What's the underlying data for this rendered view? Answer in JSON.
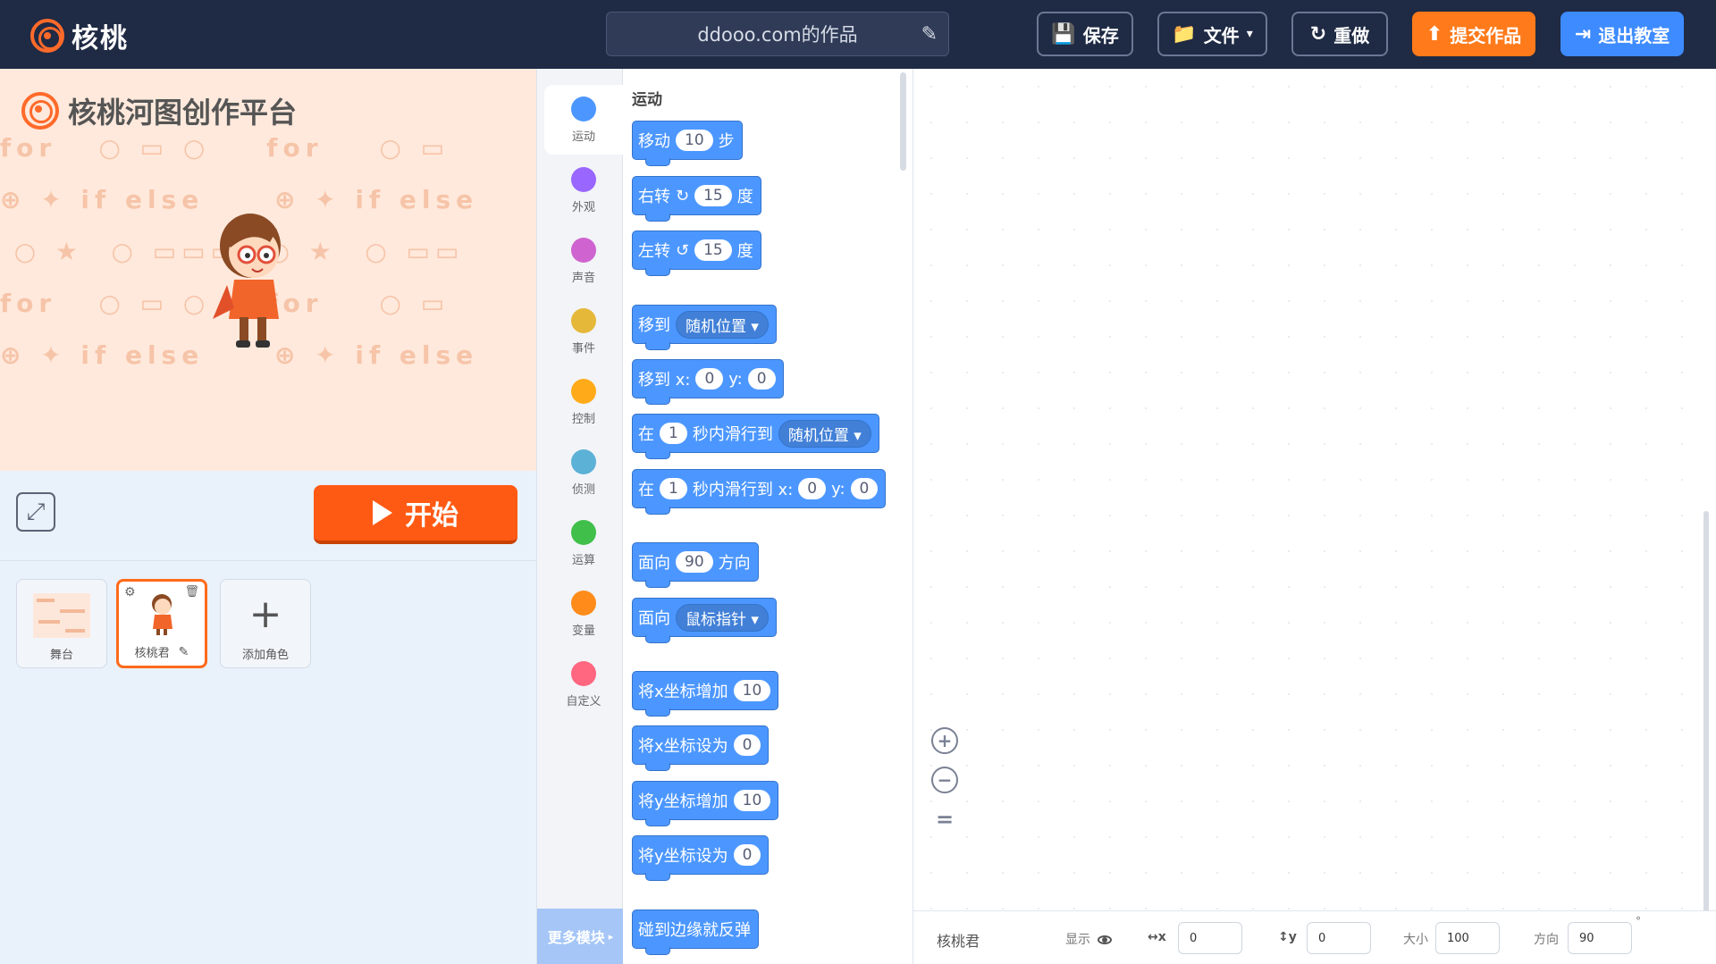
{
  "app": {
    "logo_text": "核桃",
    "brand": "核桃河图创作平台"
  },
  "header": {
    "project_title": "ddooo.com的作品",
    "buttons": {
      "save": "保存",
      "file": "文件",
      "redo": "重做",
      "submit": "提交作品",
      "exit": "退出教室"
    }
  },
  "stage": {
    "start_label": "开始",
    "pattern_words": [
      "for",
      "if else"
    ]
  },
  "sprites": {
    "stage_card": "舞台",
    "sprite_card": "核桃君",
    "add_card": "添加角色"
  },
  "categories": [
    {
      "label": "运动",
      "color": "#4c97ff"
    },
    {
      "label": "外观",
      "color": "#9966ff"
    },
    {
      "label": "声音",
      "color": "#cf63cf"
    },
    {
      "label": "事件",
      "color": "#e6b83a"
    },
    {
      "label": "控制",
      "color": "#ffab19"
    },
    {
      "label": "侦测",
      "color": "#5cb1d6"
    },
    {
      "label": "运算",
      "color": "#40bf4a"
    },
    {
      "label": "变量",
      "color": "#ff8c1a"
    },
    {
      "label": "自定义",
      "color": "#ff6680"
    }
  ],
  "more_modules": "更多模块",
  "palette": {
    "title": "运动",
    "blocks": {
      "move": {
        "a": "移动",
        "v": "10",
        "b": "步"
      },
      "turn_right": {
        "a": "右转",
        "v": "15",
        "b": "度"
      },
      "turn_left": {
        "a": "左转",
        "v": "15",
        "b": "度"
      },
      "goto": {
        "a": "移到",
        "d": "随机位置"
      },
      "goto_xy": {
        "a": "移到 x:",
        "x": "0",
        "b": "y:",
        "y": "0"
      },
      "glide": {
        "a": "在",
        "v": "1",
        "b": "秒内滑行到",
        "d": "随机位置"
      },
      "glide_xy": {
        "a": "在",
        "v": "1",
        "b": "秒内滑行到 x:",
        "x": "0",
        "c": "y:",
        "y": "0"
      },
      "point_dir": {
        "a": "面向",
        "v": "90",
        "b": "方向"
      },
      "point_towards": {
        "a": "面向",
        "d": "鼠标指针"
      },
      "change_x": {
        "a": "将x坐标增加",
        "v": "10"
      },
      "set_x": {
        "a": "将x坐标设为",
        "v": "0"
      },
      "change_y": {
        "a": "将y坐标增加",
        "v": "10"
      },
      "set_y": {
        "a": "将y坐标设为",
        "v": "0"
      },
      "bounce": {
        "a": "碰到边缘就反弹"
      }
    }
  },
  "properties": {
    "sprite_name": "核桃君",
    "show_label": "显示",
    "x_label": "x",
    "x_value": "0",
    "y_label": "y",
    "y_value": "0",
    "size_label": "大小",
    "size_value": "100",
    "direction_label": "方向",
    "direction_value": "90",
    "degree_symbol": "°"
  }
}
